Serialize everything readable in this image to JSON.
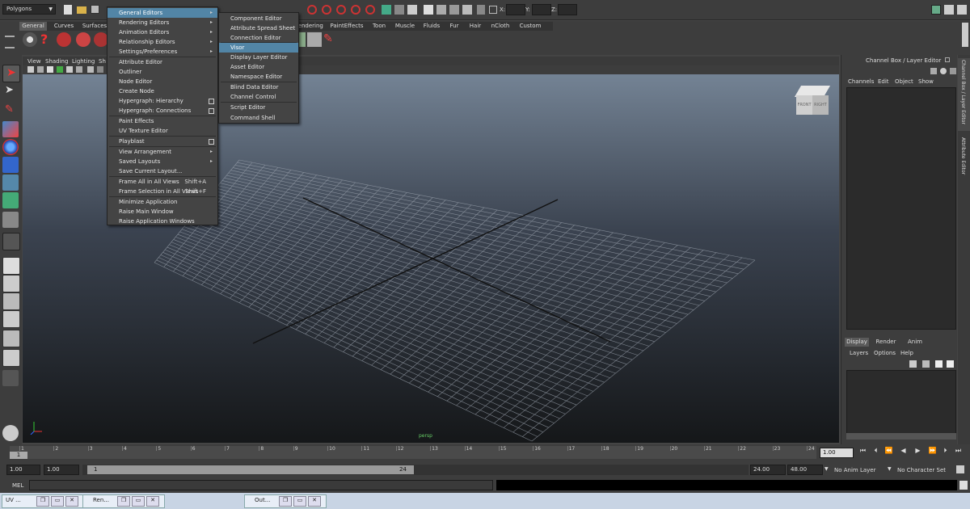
{
  "status_line": {
    "mode_menu": "Polygons",
    "xyz": {
      "x_label": "X:",
      "y_label": "Y:",
      "z_label": "Z:"
    }
  },
  "shelf": {
    "tabs": [
      "General",
      "Curves",
      "Surfaces",
      "Rendering",
      "PaintEffects",
      "Toon",
      "Muscle",
      "Fluids",
      "Fur",
      "Hair",
      "nCloth",
      "Custom"
    ]
  },
  "viewport": {
    "menu": [
      "View",
      "Shading",
      "Lighting",
      "Sh"
    ],
    "viewcube_front": "FRONT",
    "viewcube_right": "RIGHT",
    "camera_label": "persp"
  },
  "main_menu": {
    "items": [
      {
        "label": "General Editors",
        "type": "arrow",
        "highlight": true
      },
      {
        "label": "Rendering Editors",
        "type": "arrow"
      },
      {
        "label": "Animation Editors",
        "type": "arrow"
      },
      {
        "label": "Relationship Editors",
        "type": "arrow"
      },
      {
        "label": "Settings/Preferences",
        "type": "arrow"
      },
      {
        "label": "Attribute Editor"
      },
      {
        "label": "Outliner"
      },
      {
        "label": "Node Editor"
      },
      {
        "label": "Create Node"
      },
      {
        "label": "Hypergraph: Hierarchy",
        "type": "box"
      },
      {
        "label": "Hypergraph: Connections",
        "type": "box"
      },
      {
        "label": "Paint Effects"
      },
      {
        "label": "UV Texture Editor"
      },
      {
        "label": "Playblast",
        "type": "box"
      },
      {
        "label": "View Arrangement",
        "type": "arrow"
      },
      {
        "label": "Saved Layouts",
        "type": "arrow"
      },
      {
        "label": "Save Current Layout..."
      },
      {
        "label": "Frame All in All Views",
        "shortcut": "Shift+A"
      },
      {
        "label": "Frame Selection in All Views",
        "shortcut": "Shift+F"
      },
      {
        "label": "Minimize Application"
      },
      {
        "label": "Raise Main Window"
      },
      {
        "label": "Raise Application Windows"
      }
    ]
  },
  "sub_menu": {
    "items": [
      {
        "label": "Component Editor"
      },
      {
        "label": "Attribute Spread Sheet"
      },
      {
        "label": "Connection Editor"
      },
      {
        "label": "Visor",
        "highlight": true
      },
      {
        "label": "Display Layer Editor"
      },
      {
        "label": "Asset Editor"
      },
      {
        "label": "Namespace Editor"
      },
      {
        "label": "Blind Data Editor"
      },
      {
        "label": "Channel Control"
      },
      {
        "label": "Script Editor"
      },
      {
        "label": "Command Shell"
      }
    ]
  },
  "channel_box": {
    "title": "Channel Box / Layer Editor",
    "menu": [
      "Channels",
      "Edit",
      "Object",
      "Show"
    ],
    "layer_tabs": [
      "Display",
      "Render",
      "Anim"
    ],
    "layer_menu": [
      "Layers",
      "Options",
      "Help"
    ],
    "side_tabs": [
      "Channel Box / Layer Editor",
      "Attribute Editor"
    ]
  },
  "time_slider": {
    "ticks": [
      "1",
      "2",
      "3",
      "4",
      "5",
      "6",
      "7",
      "8",
      "9",
      "10",
      "11",
      "12",
      "13",
      "14",
      "15",
      "16",
      "17",
      "18",
      "19",
      "20",
      "21",
      "22",
      "23",
      "24"
    ],
    "current_frame": "1.00",
    "current_frame_marker": "1"
  },
  "range_slider": {
    "start": "1.00",
    "start_inner": "1.00",
    "range_start_label": "1",
    "range_end_label": "24",
    "end_inner": "24.00",
    "end": "48.00",
    "anim_layer": "No Anim Layer",
    "character_set": "No Character Set"
  },
  "command_line": {
    "label": "MEL"
  },
  "taskbar": {
    "items": [
      "UV ...",
      "Ren...",
      "Out..."
    ]
  },
  "colors": {
    "menu_highlight": "#5285a6",
    "viewport_top": "#7a8a9c",
    "viewport_bottom": "#151719"
  }
}
